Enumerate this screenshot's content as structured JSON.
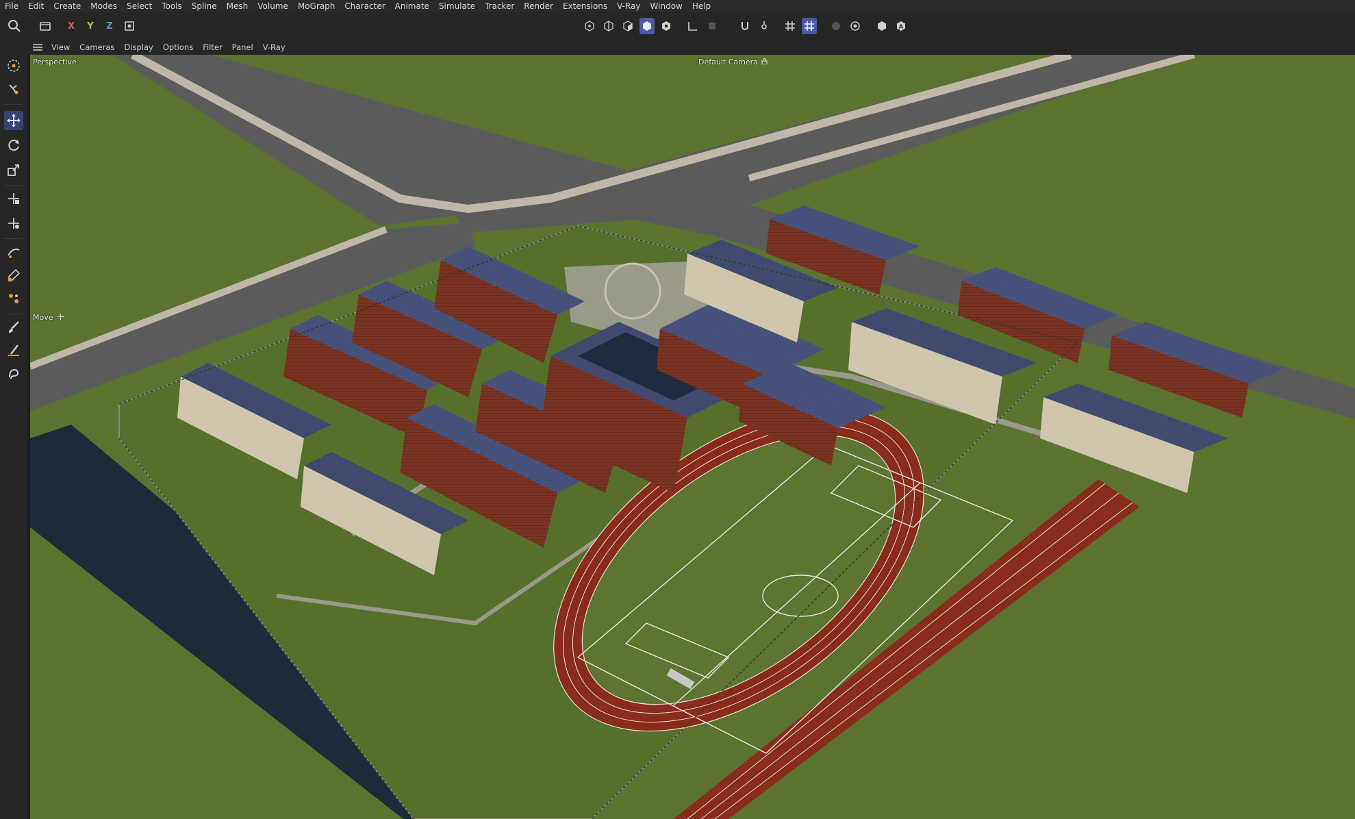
{
  "menubar": {
    "items": [
      "File",
      "Edit",
      "Create",
      "Modes",
      "Select",
      "Tools",
      "Spline",
      "Mesh",
      "Volume",
      "MoGraph",
      "Character",
      "Animate",
      "Simulate",
      "Tracker",
      "Render",
      "Extensions",
      "V-Ray",
      "Window",
      "Help"
    ]
  },
  "toolbar": {
    "axis_x": "X",
    "axis_y": "Y",
    "axis_z": "Z",
    "icons": [
      "undo-history-icon",
      "axis-x-icon",
      "axis-y-icon",
      "axis-z-icon",
      "coordinate-system-icon",
      "points-mode-icon",
      "edges-mode-icon",
      "polygons-mode-icon",
      "model-mode-icon",
      "texture-mode-icon",
      "workplane-icon",
      "solo-icon",
      "snap-icon",
      "snap-settings-icon",
      "grid-icon",
      "grid-snap-icon",
      "render-view-icon",
      "render-settings-icon",
      "cube-icon",
      "text-icon"
    ]
  },
  "viewport_menu": {
    "items": [
      "View",
      "Cameras",
      "Display",
      "Options",
      "Filter",
      "Panel",
      "V-Ray"
    ]
  },
  "viewport": {
    "name": "Perspective",
    "camera": "Default Camera",
    "tool_hint": "Move"
  },
  "colors": {
    "accent": "#4b5aa8",
    "grass": "#5c7330",
    "road": "#5b5b5b",
    "track": "#8a2c1c",
    "brick": "#7a3322",
    "roof": "#3f4a6e",
    "water": "#1d2a3a",
    "beige": "#cfc6ad"
  }
}
